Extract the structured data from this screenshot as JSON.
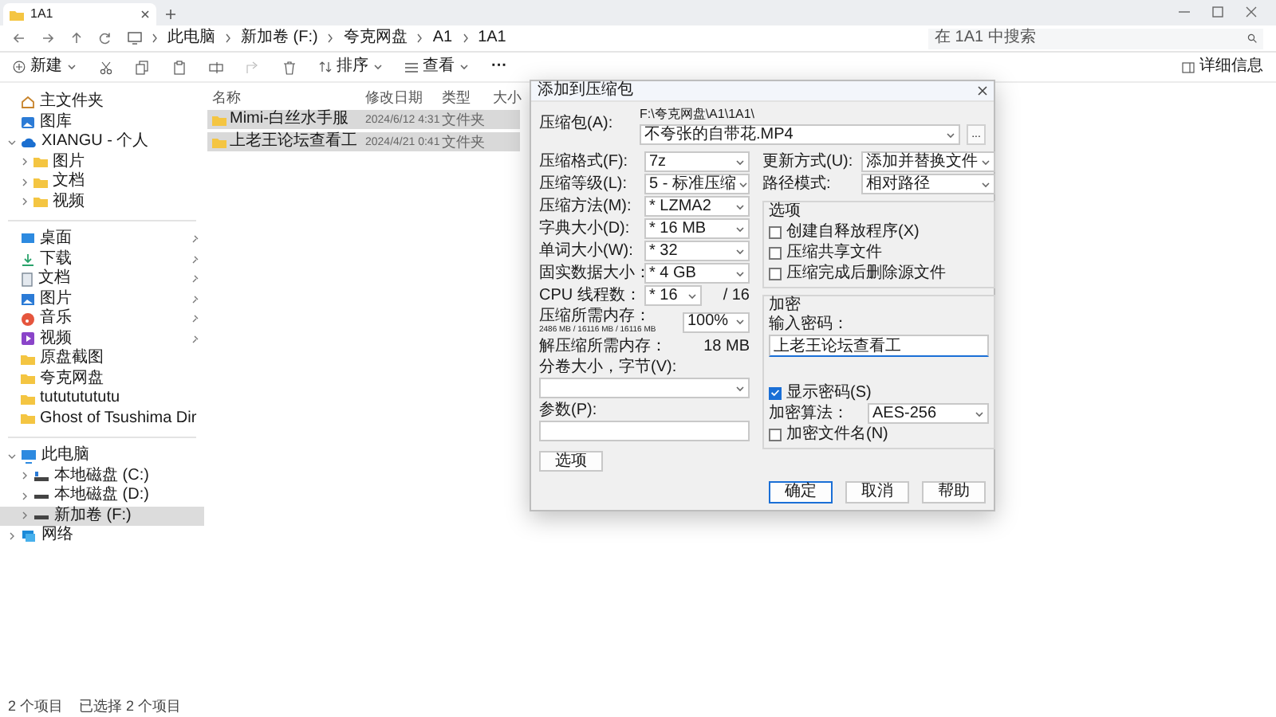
{
  "tab": {
    "title": "1A1"
  },
  "breadcrumb": [
    "此电脑",
    "新加卷 (F:)",
    "夸克网盘",
    "A1",
    "1A1"
  ],
  "search": {
    "placeholder": "在 1A1 中搜索"
  },
  "toolbar": {
    "new": "新建",
    "sort": "排序",
    "view": "查看",
    "more": "···",
    "details": "详细信息"
  },
  "columns": [
    "名称",
    "修改日期",
    "类型",
    "大小"
  ],
  "rows": [
    {
      "name": "Mimi-白丝水手服",
      "date": "2024/6/12 4:31",
      "type": "文件夹",
      "selected": true
    },
    {
      "name": "上老王论坛查看工",
      "date": "2024/4/21 0:41",
      "type": "文件夹",
      "selected": true
    }
  ],
  "sidebar": {
    "sections": [
      [
        {
          "label": "主文件夹",
          "kind": "home",
          "selected": false
        },
        {
          "label": "图库",
          "kind": "gallery",
          "selected": false
        },
        {
          "label": "XIANGU - 个人",
          "kind": "cloud",
          "expanded": true,
          "selected": false,
          "children": [
            {
              "label": "图片",
              "kind": "folder",
              "expanded": false,
              "selected": false
            },
            {
              "label": "文档",
              "kind": "folder",
              "expanded": false,
              "selected": false
            },
            {
              "label": "视频",
              "kind": "folder",
              "expanded": false,
              "selected": false
            }
          ]
        }
      ],
      [
        {
          "label": "桌面",
          "kind": "desktop",
          "pinned": true,
          "selected": false
        },
        {
          "label": "下载",
          "kind": "download",
          "pinned": true,
          "selected": false
        },
        {
          "label": "文档",
          "kind": "document",
          "pinned": true,
          "selected": false
        },
        {
          "label": "图片",
          "kind": "pictures",
          "pinned": true,
          "selected": false
        },
        {
          "label": "音乐",
          "kind": "music",
          "pinned": true,
          "selected": false
        },
        {
          "label": "视频",
          "kind": "video",
          "pinned": true,
          "selected": false
        },
        {
          "label": "原盘截图",
          "kind": "folder",
          "pinned": false,
          "selected": false
        },
        {
          "label": "夸克网盘",
          "kind": "folder",
          "pinned": false,
          "selected": false
        },
        {
          "label": "tutututututu",
          "kind": "folder",
          "pinned": false,
          "selected": false
        },
        {
          "label": "Ghost of Tsushima Dir",
          "kind": "folder",
          "pinned": false,
          "selected": false
        }
      ],
      [
        {
          "label": "此电脑",
          "kind": "pc",
          "expanded": true,
          "selected": false,
          "children": [
            {
              "label": "本地磁盘 (C:)",
              "kind": "system-drive",
              "expanded": false,
              "selected": false
            },
            {
              "label": "本地磁盘 (D:)",
              "kind": "drive",
              "expanded": false,
              "selected": false
            },
            {
              "label": "新加卷 (F:)",
              "kind": "drive",
              "expanded": false,
              "selected": true
            }
          ]
        },
        {
          "label": "网络",
          "kind": "network",
          "expanded": false,
          "selected": false
        }
      ]
    ]
  },
  "status_bar": [
    "2 个项目",
    "已选择 2 个项目"
  ],
  "dialog": {
    "title": "添加到压缩包",
    "archive": {
      "label": "压缩包(A):",
      "path": "F:\\夸克网盘\\A1\\1A1\\",
      "value": "不夸张的自带花.MP4",
      "browse_button": "..."
    },
    "left_fields": [
      {
        "label": "压缩格式(F):",
        "value": "7z"
      },
      {
        "label": "压缩等级(L):",
        "value": "5 - 标准压缩"
      },
      {
        "label": "压缩方法(M):",
        "value": "* LZMA2"
      },
      {
        "label": "字典大小(D):",
        "value": "* 16 MB"
      },
      {
        "label": "单词大小(W):",
        "value": "* 32"
      },
      {
        "label": "固实数据大小：",
        "value": "* 4 GB"
      },
      {
        "label": "CPU 线程数：",
        "value": "* 16",
        "note": "/ 16"
      }
    ],
    "memory": {
      "label": "压缩所需内存：",
      "detail": "2486 MB / 16116 MB / 16116 MB",
      "value": "100%"
    },
    "decompress": {
      "label": "解压缩所需内存：",
      "value": "18 MB"
    },
    "volume": {
      "label": "分卷大小，字节(V):"
    },
    "params": {
      "label": "参数(P):"
    },
    "options_button": "选项",
    "right_fields": [
      {
        "label": "更新方式(U):",
        "value": "添加并替换文件"
      },
      {
        "label": "路径模式:",
        "value": "相对路径"
      }
    ],
    "options_group": {
      "title": "选项",
      "items": [
        {
          "label": "创建自释放程序(X)",
          "checked": false
        },
        {
          "label": "压缩共享文件",
          "checked": false
        },
        {
          "label": "压缩完成后删除源文件",
          "checked": false
        }
      ]
    },
    "encryption": {
      "title": "加密",
      "password_label": "输入密码：",
      "password": "上老王论坛查看工",
      "show_password": {
        "label": "显示密码(S)",
        "checked": true
      },
      "method": {
        "label": "加密算法：",
        "value": "AES-256"
      },
      "encrypt_names": {
        "label": "加密文件名(N)",
        "checked": false
      }
    },
    "buttons": [
      "确定",
      "取消",
      "帮助"
    ]
  }
}
